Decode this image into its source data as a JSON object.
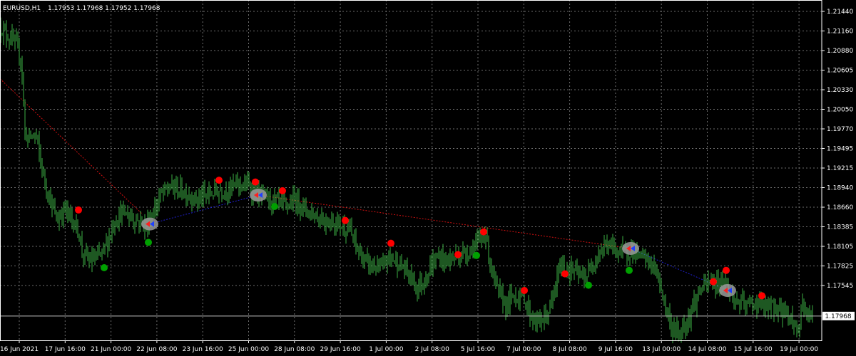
{
  "window": {
    "symbol_label": "EURUSD,H1",
    "ohlc_label": "1.17953 1.17968 1.17952 1.17968"
  },
  "colors": {
    "background": "#000000",
    "grid": "#6e6e6e",
    "frame": "#ffffff",
    "candle": "#3cb043",
    "price_line": "#c0c0c0",
    "marker_red": "#ff0000",
    "marker_green": "#00a000",
    "trend_red": "#d01010",
    "trend_blue": "#2020d0"
  },
  "chart_data": {
    "type": "candlestick",
    "symbol": "EURUSD",
    "timeframe": "H1",
    "ylim": [
      1.1769,
      1.2158
    ],
    "y_ticks": [
      "1.21440",
      "1.21160",
      "1.20880",
      "1.20605",
      "1.20330",
      "1.20050",
      "1.19770",
      "1.19495",
      "1.19215",
      "1.18940",
      "1.18660",
      "1.18385",
      "1.18105",
      "1.17825",
      "1.17545"
    ],
    "current_price": "1.17968",
    "x_ticks": [
      "16 Jun 2021",
      "17 Jun 16:00",
      "21 Jun 00:00",
      "22 Jun 08:00",
      "23 Jun 16:00",
      "25 Jun 00:00",
      "28 Jun 08:00",
      "29 Jun 16:00",
      "1 Jul 00:00",
      "2 Jul 08:00",
      "5 Jul 16:00",
      "7 Jul 00:00",
      "8 Jul 08:00",
      "9 Jul 16:00",
      "13 Jul 00:00",
      "14 Jul 08:00",
      "15 Jul 16:00",
      "19 Jul 00:00"
    ],
    "price_path": [
      [
        0,
        1.2128
      ],
      [
        10,
        1.2118
      ],
      [
        20,
        1.211
      ],
      [
        30,
        1.209
      ],
      [
        35,
        1.2005
      ],
      [
        40,
        1.2
      ],
      [
        50,
        1.2005
      ],
      [
        60,
        1.196
      ],
      [
        70,
        1.193
      ],
      [
        80,
        1.1905
      ],
      [
        90,
        1.192
      ],
      [
        100,
        1.1908
      ],
      [
        110,
        1.1895
      ],
      [
        115,
        1.187
      ],
      [
        125,
        1.186
      ],
      [
        140,
        1.1865
      ],
      [
        150,
        1.188
      ],
      [
        160,
        1.1905
      ],
      [
        170,
        1.1915
      ],
      [
        180,
        1.1912
      ],
      [
        195,
        1.1905
      ],
      [
        205,
        1.19
      ],
      [
        215,
        1.1915
      ],
      [
        225,
        1.1935
      ],
      [
        240,
        1.1945
      ],
      [
        260,
        1.1938
      ],
      [
        275,
        1.193
      ],
      [
        290,
        1.1935
      ],
      [
        305,
        1.194
      ],
      [
        320,
        1.1942
      ],
      [
        335,
        1.1948
      ],
      [
        350,
        1.1945
      ],
      [
        360,
        1.1935
      ],
      [
        370,
        1.1933
      ],
      [
        385,
        1.1928
      ],
      [
        400,
        1.1922
      ],
      [
        415,
        1.193
      ],
      [
        430,
        1.1918
      ],
      [
        445,
        1.191
      ],
      [
        460,
        1.1905
      ],
      [
        475,
        1.1903
      ],
      [
        490,
        1.1895
      ],
      [
        500,
        1.1875
      ],
      [
        510,
        1.186
      ],
      [
        520,
        1.1855
      ],
      [
        535,
        1.185
      ],
      [
        545,
        1.1865
      ],
      [
        555,
        1.186
      ],
      [
        570,
        1.1848
      ],
      [
        585,
        1.183
      ],
      [
        595,
        1.1838
      ],
      [
        605,
        1.1855
      ],
      [
        615,
        1.1865
      ],
      [
        625,
        1.186
      ],
      [
        640,
        1.1865
      ],
      [
        655,
        1.187
      ],
      [
        670,
        1.188
      ],
      [
        680,
        1.1893
      ],
      [
        690,
        1.1845
      ],
      [
        700,
        1.182
      ],
      [
        710,
        1.181
      ],
      [
        720,
        1.182
      ],
      [
        735,
        1.1818
      ],
      [
        745,
        1.1795
      ],
      [
        755,
        1.179
      ],
      [
        765,
        1.1795
      ],
      [
        775,
        1.1815
      ],
      [
        785,
        1.1855
      ],
      [
        795,
        1.185
      ],
      [
        805,
        1.1848
      ],
      [
        815,
        1.184
      ],
      [
        825,
        1.1845
      ],
      [
        835,
        1.1865
      ],
      [
        845,
        1.1875
      ],
      [
        855,
        1.1878
      ],
      [
        865,
        1.1872
      ],
      [
        875,
        1.1868
      ],
      [
        885,
        1.1873
      ],
      [
        895,
        1.1865
      ],
      [
        905,
        1.1862
      ],
      [
        915,
        1.1855
      ],
      [
        925,
        1.1835
      ],
      [
        935,
        1.18
      ],
      [
        945,
        1.1778
      ],
      [
        955,
        1.178
      ],
      [
        965,
        1.1795
      ],
      [
        975,
        1.1815
      ],
      [
        985,
        1.183
      ],
      [
        995,
        1.1835
      ],
      [
        1005,
        1.1833
      ],
      [
        1015,
        1.184
      ],
      [
        1025,
        1.182
      ],
      [
        1035,
        1.1812
      ],
      [
        1045,
        1.1808
      ],
      [
        1055,
        1.1812
      ],
      [
        1065,
        1.181
      ],
      [
        1075,
        1.1805
      ],
      [
        1085,
        1.1808
      ],
      [
        1095,
        1.1803
      ],
      [
        1105,
        1.18
      ],
      [
        1115,
        1.1785
      ],
      [
        1120,
        1.178
      ],
      [
        1125,
        1.1815
      ],
      [
        1130,
        1.18
      ],
      [
        1140,
        1.1797
      ]
    ],
    "red_markers": [
      [
        110,
        1.1918
      ],
      [
        307,
        1.1952
      ],
      [
        358,
        1.195
      ],
      [
        396,
        1.194
      ],
      [
        484,
        1.1906
      ],
      [
        548,
        1.188
      ],
      [
        642,
        1.1867
      ],
      [
        678,
        1.1893
      ],
      [
        735,
        1.1826
      ],
      [
        792,
        1.1845
      ],
      [
        1000,
        1.1836
      ],
      [
        1018,
        1.1849
      ],
      [
        1068,
        1.182
      ]
    ],
    "green_markers": [
      [
        146,
        1.1852
      ],
      [
        208,
        1.1881
      ],
      [
        385,
        1.1922
      ],
      [
        668,
        1.1866
      ],
      [
        825,
        1.1832
      ],
      [
        882,
        1.1849
      ]
    ],
    "trade_markers": [
      [
        210,
        1.1902
      ],
      [
        362,
        1.1935
      ],
      [
        884,
        1.1874
      ],
      [
        1020,
        1.1826
      ]
    ],
    "trend_lines": [
      {
        "color_key": "trend_red",
        "points": [
          [
            0,
            1.2068
          ],
          [
            200,
            1.1913
          ]
        ]
      },
      {
        "color_key": "trend_blue",
        "points": [
          [
            210,
            1.1902
          ],
          [
            362,
            1.1935
          ]
        ]
      },
      {
        "color_key": "trend_red",
        "points": [
          [
            362,
            1.1935
          ],
          [
            884,
            1.1874
          ]
        ]
      },
      {
        "color_key": "trend_blue",
        "points": [
          [
            884,
            1.1874
          ],
          [
            1020,
            1.1826
          ]
        ]
      }
    ]
  }
}
